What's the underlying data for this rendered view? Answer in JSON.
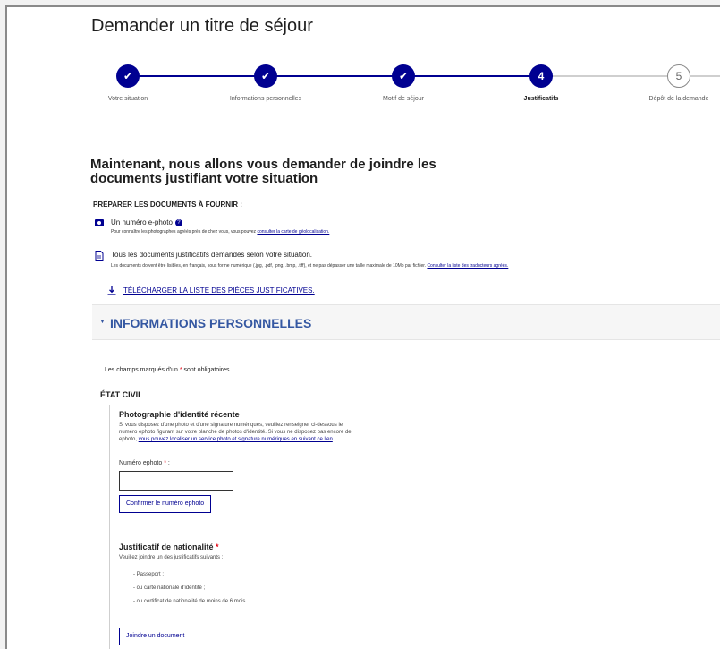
{
  "page": {
    "title": "Demander un titre de séjour"
  },
  "stepper": {
    "steps": [
      {
        "number": "",
        "label": "Votre situation",
        "state": "done"
      },
      {
        "number": "",
        "label": "Informations personnelles",
        "state": "done"
      },
      {
        "number": "",
        "label": "Motif de séjour",
        "state": "done"
      },
      {
        "number": "4",
        "label": "Justificatifs",
        "state": "current"
      },
      {
        "number": "5",
        "label": "Dépôt de la demande",
        "state": "todo"
      }
    ],
    "colors": {
      "accent": "#000091",
      "todo": "#cfcfcf"
    }
  },
  "intro": {
    "heading": "Maintenant, nous allons vous demander de joindre les documents justifiant votre situation",
    "prep_title": "PRÉPARER LES DOCUMENTS À FOURNIR :",
    "ephoto": {
      "icon": "camera-icon",
      "title": "Un numéro e-photo",
      "desc_prefix": "Pour connaître les photographes agréés près de chez vous, vous pouvez ",
      "desc_link": "consulter la carte de géolocalisation."
    },
    "docs": {
      "icon": "document-icon",
      "title": "Tous les documents justificatifs demandés selon votre situation.",
      "desc_prefix": "Les documents doivent être lisibles, en français, sous forme numérique (.jpg, .pdf, .png, .bmp, .tiff), et ne pas dépasser une taille maximale de 10Mo par fichier. ",
      "desc_link": "Consulter la liste des traducteurs agréés."
    },
    "download_label": "TÉLÉCHARGER LA LISTE DES PIÈCES JUSTIFICATIVES."
  },
  "accordion": {
    "title": "INFORMATIONS PERSONNELLES"
  },
  "form": {
    "required_prefix": "Les champs marqués d'un ",
    "required_star": "*",
    "required_suffix": " sont obligatoires.",
    "etat_civil": "ÉTAT CIVIL",
    "photo": {
      "title": "Photographie d'identité récente",
      "desc": "Si vous disposez d'une photo et d'une signature numériques, veuillez renseigner ci-dessous le numéro ephoto figurant sur votre planche de photos d'identité. Si vous ne disposez pas encore de ephoto, ",
      "desc_link": "vous pouvez localiser un service photo et signature numériques en suivant ce lien",
      "desc_end": ".",
      "field_label": "Numéro ephoto",
      "field_star": "*",
      "field_suffix": " :",
      "value": "",
      "confirm_label": "Confirmer le numéro ephoto"
    },
    "nationality": {
      "title": "Justificatif de nationalité",
      "star": "*",
      "desc": "Veuillez joindre un des justificatifs suivants :",
      "items": [
        "- Passeport ;",
        "- ou carte nationale d'identité ;",
        "- ou certificat de nationalité de moins de 6 mois."
      ],
      "button_label": "Joindre un document"
    }
  }
}
